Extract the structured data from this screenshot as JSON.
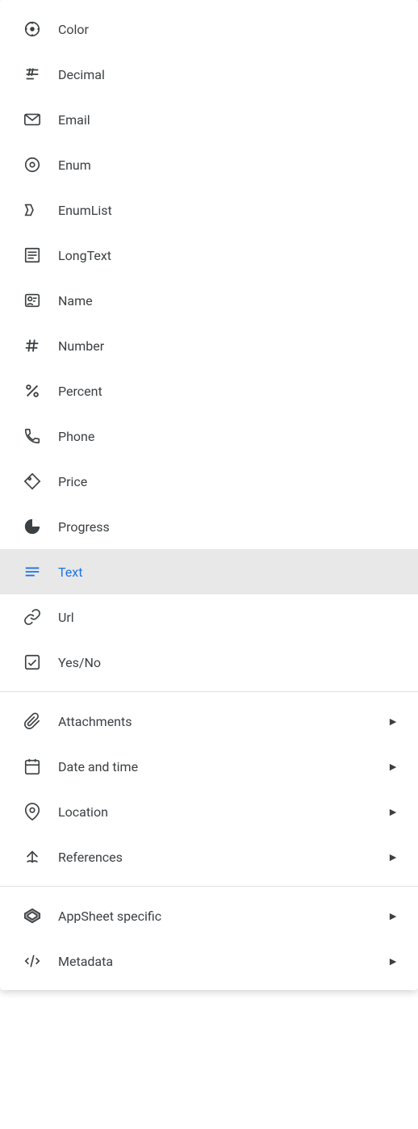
{
  "menu": {
    "items": [
      {
        "id": "color",
        "label": "Color",
        "icon": "color-icon",
        "selected": false,
        "hasSubmenu": false,
        "group": 1
      },
      {
        "id": "decimal",
        "label": "Decimal",
        "icon": "decimal-icon",
        "selected": false,
        "hasSubmenu": false,
        "group": 1
      },
      {
        "id": "email",
        "label": "Email",
        "icon": "email-icon",
        "selected": false,
        "hasSubmenu": false,
        "group": 1
      },
      {
        "id": "enum",
        "label": "Enum",
        "icon": "enum-icon",
        "selected": false,
        "hasSubmenu": false,
        "group": 1
      },
      {
        "id": "enumlist",
        "label": "EnumList",
        "icon": "enumlist-icon",
        "selected": false,
        "hasSubmenu": false,
        "group": 1
      },
      {
        "id": "longtext",
        "label": "LongText",
        "icon": "longtext-icon",
        "selected": false,
        "hasSubmenu": false,
        "group": 1
      },
      {
        "id": "name",
        "label": "Name",
        "icon": "name-icon",
        "selected": false,
        "hasSubmenu": false,
        "group": 1
      },
      {
        "id": "number",
        "label": "Number",
        "icon": "number-icon",
        "selected": false,
        "hasSubmenu": false,
        "group": 1
      },
      {
        "id": "percent",
        "label": "Percent",
        "icon": "percent-icon",
        "selected": false,
        "hasSubmenu": false,
        "group": 1
      },
      {
        "id": "phone",
        "label": "Phone",
        "icon": "phone-icon",
        "selected": false,
        "hasSubmenu": false,
        "group": 1
      },
      {
        "id": "price",
        "label": "Price",
        "icon": "price-icon",
        "selected": false,
        "hasSubmenu": false,
        "group": 1
      },
      {
        "id": "progress",
        "label": "Progress",
        "icon": "progress-icon",
        "selected": false,
        "hasSubmenu": false,
        "group": 1
      },
      {
        "id": "text",
        "label": "Text",
        "icon": "text-icon",
        "selected": true,
        "hasSubmenu": false,
        "group": 1
      },
      {
        "id": "url",
        "label": "Url",
        "icon": "url-icon",
        "selected": false,
        "hasSubmenu": false,
        "group": 1
      },
      {
        "id": "yesno",
        "label": "Yes/No",
        "icon": "yesno-icon",
        "selected": false,
        "hasSubmenu": false,
        "group": 1
      },
      {
        "id": "attachments",
        "label": "Attachments",
        "icon": "attachments-icon",
        "selected": false,
        "hasSubmenu": true,
        "group": 2
      },
      {
        "id": "dateandtime",
        "label": "Date and time",
        "icon": "dateandtime-icon",
        "selected": false,
        "hasSubmenu": true,
        "group": 2
      },
      {
        "id": "location",
        "label": "Location",
        "icon": "location-icon",
        "selected": false,
        "hasSubmenu": true,
        "group": 2
      },
      {
        "id": "references",
        "label": "References",
        "icon": "references-icon",
        "selected": false,
        "hasSubmenu": true,
        "group": 2
      },
      {
        "id": "appsheet",
        "label": "AppSheet specific",
        "icon": "appsheet-icon",
        "selected": false,
        "hasSubmenu": true,
        "group": 3
      },
      {
        "id": "metadata",
        "label": "Metadata",
        "icon": "metadata-icon",
        "selected": false,
        "hasSubmenu": true,
        "group": 3
      }
    ]
  }
}
